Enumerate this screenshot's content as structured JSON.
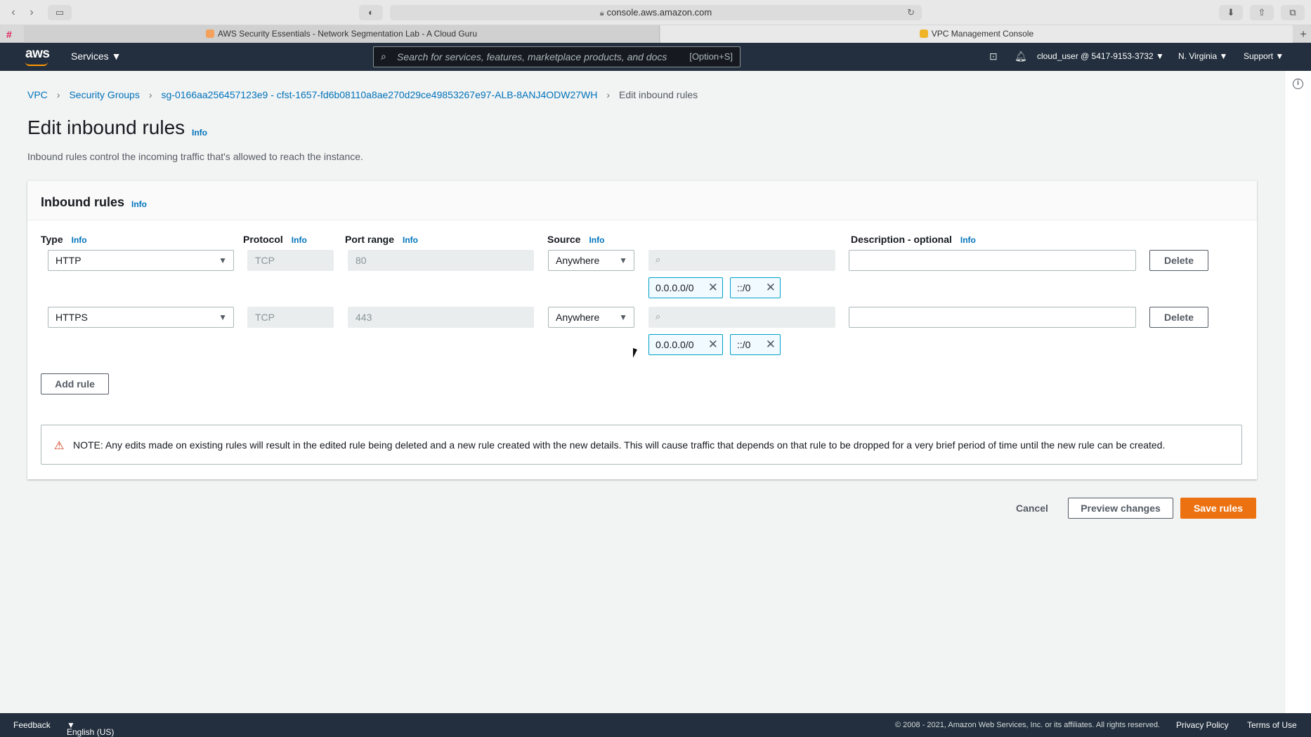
{
  "browser": {
    "url": "console.aws.amazon.com",
    "tabs": [
      {
        "label": "AWS Security Essentials - Network Segmentation Lab - A Cloud Guru"
      },
      {
        "label": "VPC Management Console"
      }
    ]
  },
  "header": {
    "logo": "aws",
    "services_label": "Services",
    "search_placeholder": "Search for services, features, marketplace products, and docs",
    "search_shortcut": "[Option+S]",
    "account": "cloud_user @ 5417-9153-3732",
    "region": "N. Virginia",
    "support": "Support"
  },
  "breadcrumb": {
    "items": [
      "VPC",
      "Security Groups",
      "sg-0166aa256457123e9 - cfst-1657-fd6b08110a8ae270d29ce49853267e97-ALB-8ANJ4ODW27WH"
    ],
    "current": "Edit inbound rules"
  },
  "page": {
    "title": "Edit inbound rules",
    "info": "Info",
    "description": "Inbound rules control the incoming traffic that's allowed to reach the instance."
  },
  "panel": {
    "title": "Inbound rules",
    "info": "Info",
    "columns": {
      "type": "Type",
      "protocol": "Protocol",
      "port_range": "Port range",
      "source": "Source",
      "description": "Description - optional"
    },
    "rules": [
      {
        "type": "HTTP",
        "protocol": "TCP",
        "port": "80",
        "source": "Anywhere",
        "cidr_v4": "0.0.0.0/0",
        "cidr_v6": "::/0",
        "delete": "Delete"
      },
      {
        "type": "HTTPS",
        "protocol": "TCP",
        "port": "443",
        "source": "Anywhere",
        "cidr_v4": "0.0.0.0/0",
        "cidr_v6": "::/0",
        "delete": "Delete"
      }
    ],
    "add_rule": "Add rule",
    "note": "NOTE: Any edits made on existing rules will result in the edited rule being deleted and a new rule created with the new details. This will cause traffic that depends on that rule to be dropped for a very brief period of time until the new rule can be created."
  },
  "actions": {
    "cancel": "Cancel",
    "preview": "Preview changes",
    "save": "Save rules"
  },
  "footer": {
    "feedback": "Feedback",
    "language": "English (US)",
    "copyright": "© 2008 - 2021, Amazon Web Services, Inc. or its affiliates. All rights reserved.",
    "privacy": "Privacy Policy",
    "terms": "Terms of Use"
  }
}
